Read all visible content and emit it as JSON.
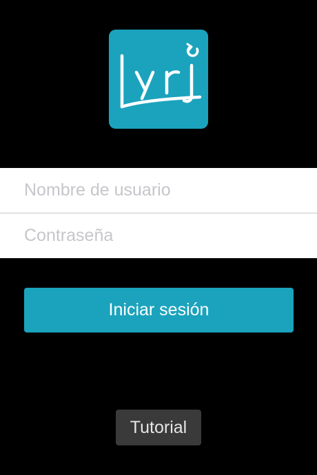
{
  "logo": {
    "wordmark": "Lyrj",
    "icon_name": "lyrj-app-logo-icon",
    "background_color": "#1ba3bd"
  },
  "login_form": {
    "username": {
      "value": "",
      "placeholder": "Nombre de usuario"
    },
    "password": {
      "value": "",
      "placeholder": "Contraseña"
    }
  },
  "buttons": {
    "login_label": "Iniciar sesión",
    "tutorial_label": "Tutorial"
  },
  "colors": {
    "accent": "#1ba3bd",
    "background": "#000000",
    "tutorial_button": "#3a3a3a"
  }
}
